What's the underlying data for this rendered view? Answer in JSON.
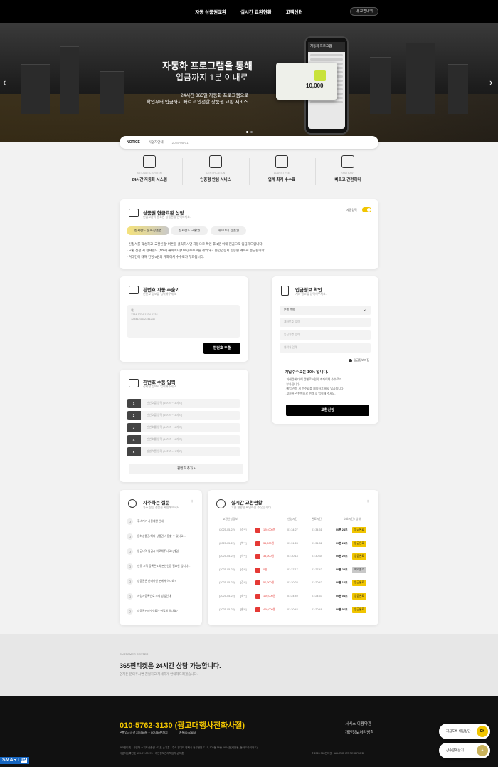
{
  "nav": {
    "items": [
      "자동 상품권교환",
      "실시간 교환현황",
      "고객센터"
    ],
    "my_button": "내 교환내역"
  },
  "hero": {
    "title": "자동화 프로그램을 통해",
    "subtitle": "입금까지 1분 이내로",
    "desc1": "24시간 365일 자동화 프로그램으로",
    "desc2": "확인부터 입금까지 빠르고 안전한 상품권 교환 서비스",
    "phone_title": "자동화 프로그램",
    "card_amount": "10,000"
  },
  "notice": {
    "label": "NOTICE",
    "text": "사업자안내",
    "date": "2025-05-01"
  },
  "features": [
    {
      "en": "AUTOMATIC SYSTEM",
      "ko": "24시간 자동화 시스템"
    },
    {
      "en": "CERTIFICATION",
      "ko": "인증형 안심 서비스"
    },
    {
      "en": "LOWEST FEE",
      "ko": "업계 최저 수수료"
    },
    {
      "en": "FAST EASY",
      "ko": "빠르고 간편하다"
    }
  ],
  "exchange": {
    "title": "상품권 현금교환 신청",
    "subtitle": "현금교환이 필요한 상품권을 선택하세요.",
    "toggle_label": "자동입력",
    "tabs": [
      "컬쳐랜드 문화상품권",
      "컬쳐랜드 교환권",
      "해피머니 상품권"
    ],
    "bullets": [
      "- 신청서를 작성하고 '교환신청' 버튼을 클릭하시면 자동으로 확인 후 1분 이내 현금으로 입금해드립니다.",
      "- 교환 신청 시 컬쳐랜드 (10%) 해피머니(10%) 수수료를 제외하고 본인인증시 인증된 계좌로 송금됩니다.",
      "- 거래건에 대해 건당 0원의 계좌이체 수수료가 부과됩니다."
    ]
  },
  "auto_pin": {
    "title": "핀번호 자동 추출기",
    "subtitle": "핀번호 정보를 입력해주세요.",
    "placeholder_lines": [
      "예)",
      "1234-1234-1234-1234",
      "1234123412341234"
    ],
    "button": "핀번호 추출"
  },
  "manual_pin": {
    "title": "핀번호 수동 입력",
    "subtitle": "정확한 정보로 입력해주세요.",
    "rows": [
      "1",
      "2",
      "3",
      "4",
      "5"
    ],
    "row_placeholder": "핀번호를 입력 (16자리~18자리)",
    "add_button": "핀번호 추가 +"
  },
  "deposit": {
    "title": "입금정보 확인",
    "subtitle": "계좌 정보를 입력해주세요.",
    "bank_select": "은행 선택",
    "fields": [
      "계좌번호 입력",
      "입금자명 입력",
      "연락처 입력"
    ],
    "save_label": "입금정보저장",
    "fee_line": "예입수수료는 10% 입니다.",
    "fee_bold": "10%",
    "notes": [
      "- 거래건에 대해 건별로 0원의 계좌이체 수수료가",
      "  부과됩니다.",
      "- 예입 신청 시 수수료를 제외하고 바로 입금됩니다.",
      "- 교환권은 핀번호로 변경 후 입력해 주세요."
    ],
    "button": "교환신청"
  },
  "faq": {
    "title": "자주하는 질문",
    "subtitle": "자주 묻는 질문을 확인해보세요.",
    "plus": "+",
    "items": [
      "휴스케기 사용제한 안내",
      "문화상품권/해피 상품권 사용할 수 있나요...",
      "입금내역 입금시 바로해주나요?(게임)",
      "신규 고객 등록은 1회 본인인증 필요한 입니다...",
      "상품권은 판매하신 분께서 아나요?",
      "사업자등록번호 조회 방법안내",
      "상품권판매수수료는 어떻게 하나요?"
    ]
  },
  "live": {
    "title": "실시간 교환현황",
    "subtitle": "교환 현황을 확인하실 수 있습니다.",
    "plus": "+",
    "headers": [
      "교환신청정보",
      "신청시간",
      "완료시간",
      "소요시간 / 상태"
    ],
    "rows": [
      {
        "date": "(2025-05-22)",
        "name": "[정**]",
        "amount": "120,000원",
        "req": "01:34:27",
        "done": "01:34:51",
        "dur": "00분 24초",
        "status": "입금완료"
      },
      {
        "date": "(2025-05-22)",
        "name": "[박**]",
        "amount": "35,000원",
        "req": "01:31:28",
        "done": "01:31:52",
        "dur": "00분 24초",
        "status": "입금완료"
      },
      {
        "date": "(2025-05-22)",
        "name": "[이**]",
        "amount": "35,000원",
        "req": "01:30:14",
        "done": "01:30:34",
        "dur": "00분 20초",
        "status": "입금완료"
      },
      {
        "date": "(2025-05-22)",
        "name": "[정**]",
        "amount": "0원",
        "req": "01:27:17",
        "done": "01:27:42",
        "dur": "00분 25초",
        "status": "예약불가"
      },
      {
        "date": "(2025-05-22)",
        "name": "[김**]",
        "amount": "50,000원",
        "req": "01:20:28",
        "done": "01:20:42",
        "dur": "00분 14초",
        "status": "입금완료"
      },
      {
        "date": "(2025-05-22)",
        "name": "[최**]",
        "amount": "100,000원",
        "req": "01:24:49",
        "done": "01:24:53",
        "dur": "00분 04초",
        "status": "입금완료"
      },
      {
        "date": "(2025-05-22)",
        "name": "[한**]",
        "amount": "400,000원",
        "req": "01:20:42",
        "done": "01:20:48",
        "dur": "00분 06초",
        "status": "입금완료"
      }
    ]
  },
  "cs": {
    "label": "CUSTOMER CENTER",
    "title": "365핀티켓은 24시간 상담 가능합니다.",
    "desc": "언제든 문의주시면 친절하고 자세하게 안내해드리겠습니다."
  },
  "footer": {
    "phone": "010-5762-3130 (광고대행사전화사절)",
    "info1": "은행입금시간 23시40분 ~ 00시30분까지",
    "info2": "카톡ID:g3658",
    "link1": "서비스 이용약관",
    "link2": "개인정보처리방침",
    "company": "365핀티켓  ·  사업자 스피드상품권  ·  대표 손지훈  ·  주소 경기도 평택시 동부공원로 11, 103동 16층 1604호(비전동, 동아트라이어트)",
    "reg": "사업자등록번호  159-97-00976  ·  개인정보관리책임자  손지훈",
    "copy": "© 2024 365핀티켓 · ALL RIGHTS RESERVED."
  },
  "floating": {
    "kakao": "지금도록 채팅상담",
    "kakao_icon": "Ch",
    "calc": "상수량계산기",
    "calc_icon": "+"
  },
  "badge": {
    "smart": "SMART",
    "ip": "IP"
  }
}
